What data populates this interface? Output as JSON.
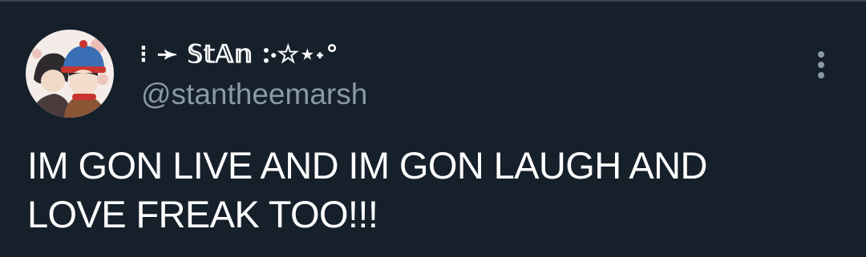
{
  "tweet": {
    "author": {
      "display_name": "⁝ ➛ 𝕊𝕥𝔸𝕟 ჻☆⋆˖°",
      "handle": "@stantheemarsh",
      "avatar": "avatar-image"
    },
    "text_lines": [
      "IM GON LIVE AND IM GON LAUGH AND",
      "LOVE FREAK TOO!!!"
    ],
    "more_icon": "more-vertical-icon"
  },
  "colors": {
    "background": "#15202b",
    "text": "#ffffff",
    "secondary_text": "#8b98a5",
    "divider": "#38444d"
  }
}
